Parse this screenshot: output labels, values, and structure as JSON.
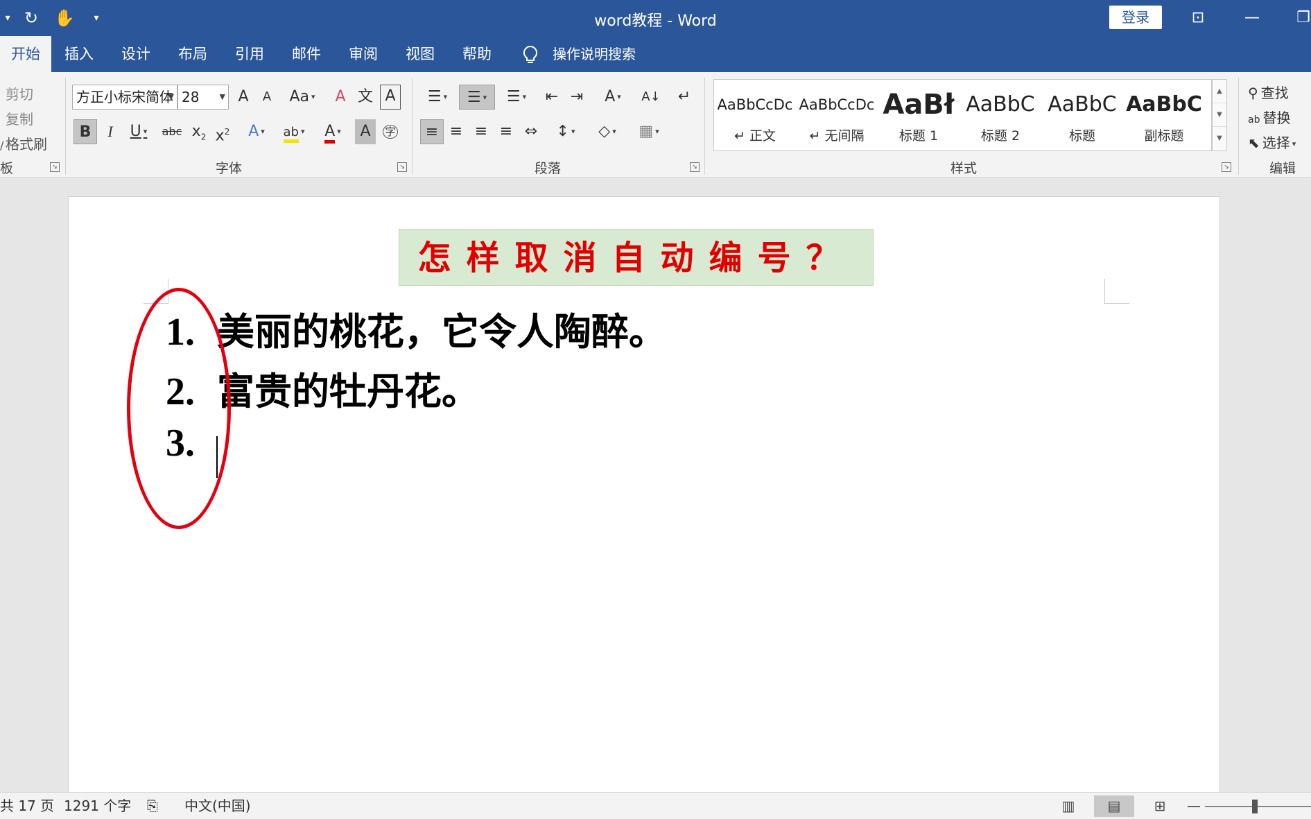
{
  "window": {
    "title": "word教程  -  Word",
    "login": "登录",
    "quick_access": {
      "undo": "▾",
      "redo": "↻",
      "touch": "✋",
      "customize": "▾"
    },
    "controls": {
      "ribbon_display": "⊡",
      "minimize": "—",
      "restore": "❐"
    }
  },
  "tabs": [
    "开始",
    "插入",
    "设计",
    "布局",
    "引用",
    "邮件",
    "审阅",
    "视图",
    "帮助"
  ],
  "tell_me": "操作说明搜索",
  "clipboard": {
    "cut": "剪切",
    "copy": "复制",
    "format_painter": "格式刷",
    "label": "板"
  },
  "font": {
    "name": "方正小标宋简体",
    "size": "28",
    "label": "字体",
    "buttons": {
      "grow": "A",
      "shrink": "A",
      "change_case": "Aa",
      "clear": "A",
      "phonetic": "文",
      "border": "A",
      "bold": "B",
      "italic": "I",
      "underline": "U",
      "strike": "abc",
      "subscript": "x",
      "superscript": "x",
      "text_effects": "A",
      "highlight": "ab",
      "font_color": "A",
      "shading": "A",
      "enclose": "字"
    }
  },
  "paragraph": {
    "label": "段落",
    "buttons": {
      "bullets": "☰",
      "numbering": "☰",
      "multilevel": "☰",
      "decrease_indent": "⇤",
      "increase_indent": "⇥",
      "chinese_layout": "A",
      "sort": "A↓",
      "show_marks": "↵",
      "align_left": "≡",
      "center": "≡",
      "align_right": "≡",
      "justify": "≡",
      "distributed": "⇔",
      "line_spacing": "↕",
      "shading": "◇",
      "borders": "▦"
    }
  },
  "styles": {
    "label": "样式",
    "items": [
      {
        "sample": "AaBbCcDc",
        "name": "↵ 正文"
      },
      {
        "sample": "AaBbCcDc",
        "name": "↵ 无间隔"
      },
      {
        "sample": "AaBł",
        "name": "标题 1"
      },
      {
        "sample": "AaBbC",
        "name": "标题 2"
      },
      {
        "sample": "AaBbC",
        "name": "标题"
      },
      {
        "sample": "AaBbC",
        "name": "副标题"
      }
    ]
  },
  "editing": {
    "find": "查找",
    "replace": "替换",
    "select": "选择",
    "label": "编辑"
  },
  "document": {
    "title": "怎样取消自动编号？",
    "list": [
      {
        "num": "1.",
        "text": "美丽的桃花，它令人陶醉。"
      },
      {
        "num": "2.",
        "text": "富贵的牡丹花。"
      },
      {
        "num": "3.",
        "text": ""
      }
    ]
  },
  "status": {
    "pages": "共 17 页",
    "words": "1291 个字",
    "language": "中文(中国)",
    "zoom_minus": "—"
  },
  "colors": {
    "title_bar": "#2b579a",
    "doc_title_text": "#e00000",
    "doc_title_bg": "#d9ead3",
    "annotation_ellipse": "#e3000f"
  }
}
